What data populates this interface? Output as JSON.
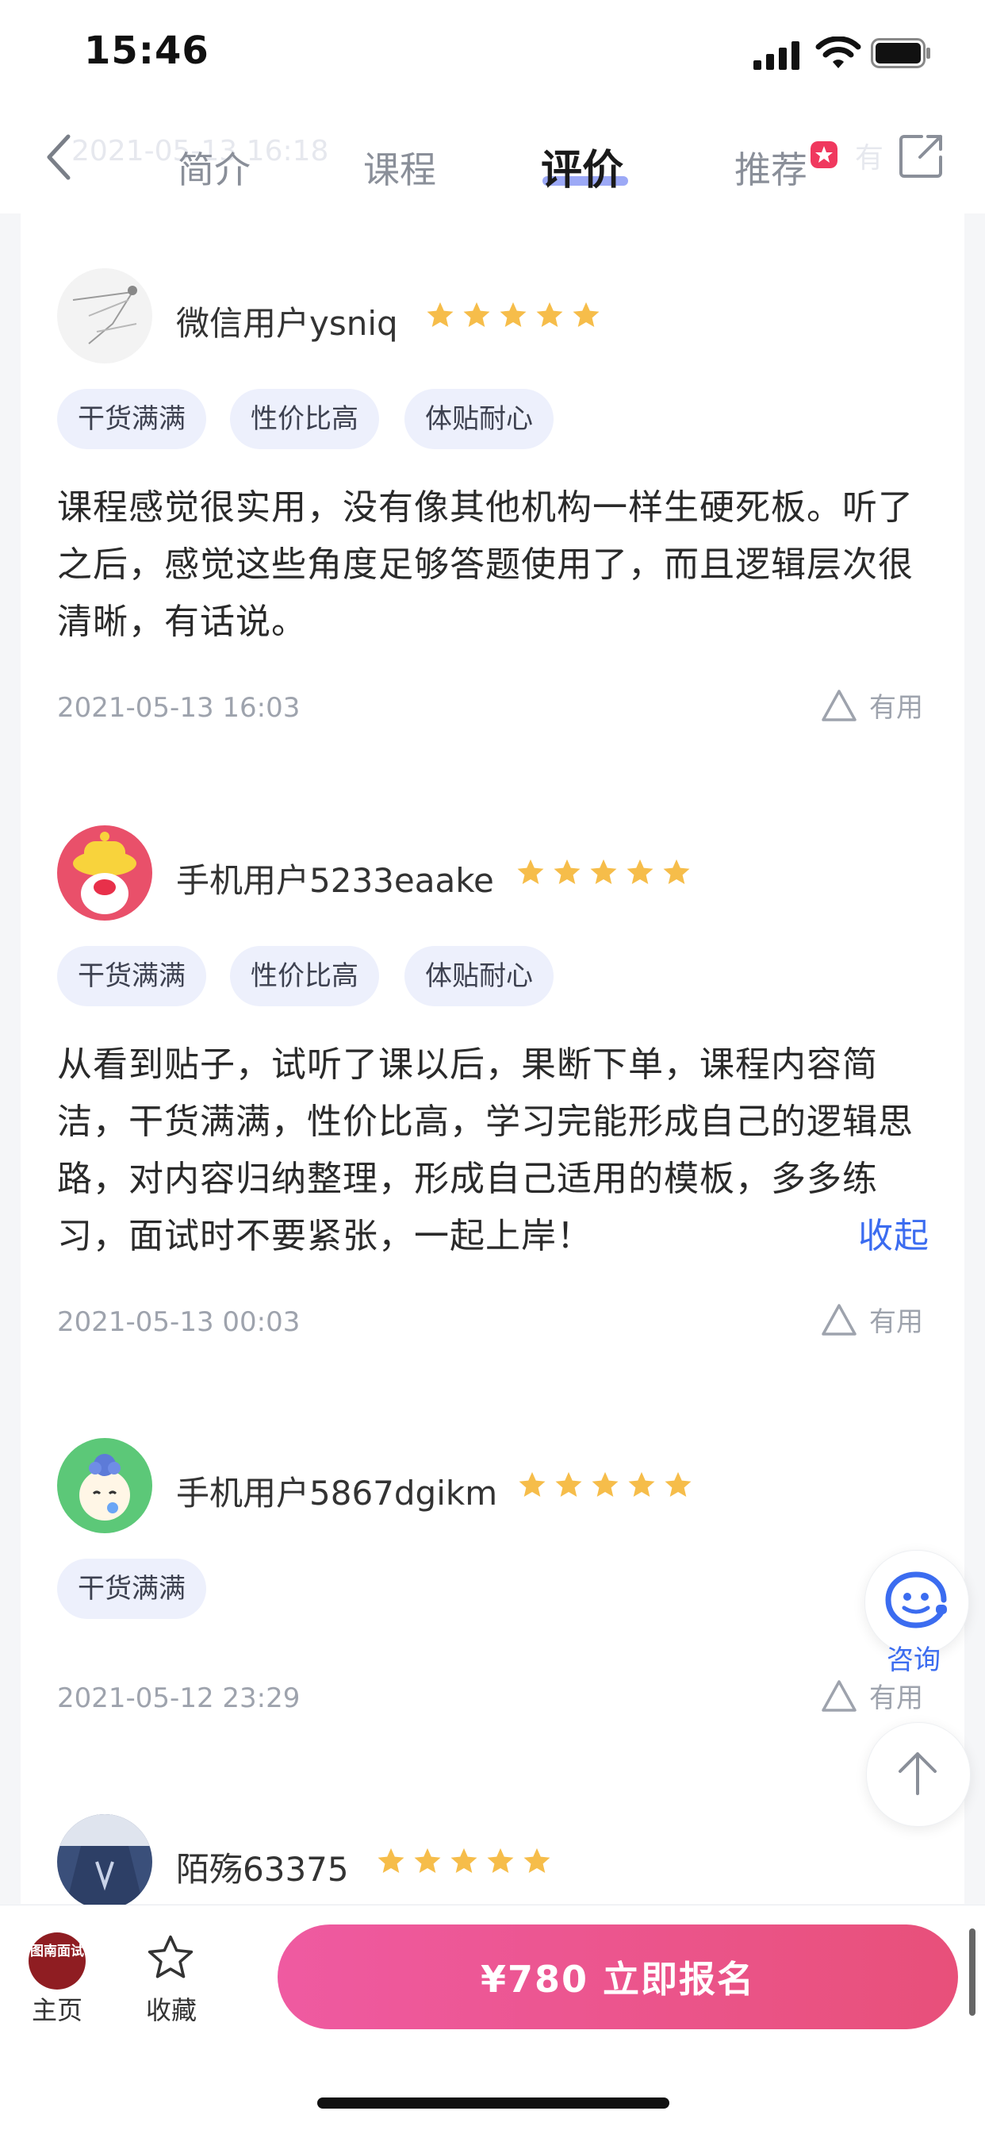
{
  "status_bar": {
    "time": "15:46"
  },
  "nav": {
    "tabs": [
      {
        "label": "简介"
      },
      {
        "label": "课程"
      },
      {
        "label": "评价",
        "active": true
      },
      {
        "label": "推荐"
      }
    ],
    "ghost_date": "2021-05-13 16:18",
    "ghost_useful": "有"
  },
  "reviews": [
    {
      "user": "微信用户ysniq",
      "rating": 5,
      "tags": [
        "干货满满",
        "性价比高",
        "体贴耐心"
      ],
      "text": "课程感觉很实用，没有像其他机构一样生硬死板。听了之后，感觉这些角度足够答题使用了，而且逻辑层次很清晰，有话说。",
      "time": "2021-05-13 16:03",
      "useful_label": "有用"
    },
    {
      "user": "手机用户5233eaake",
      "rating": 5,
      "tags": [
        "干货满满",
        "性价比高",
        "体贴耐心"
      ],
      "text": "从看到贴子，试听了课以后，果断下单，课程内容简洁，干货满满，性价比高，学习完能形成自己的逻辑思路，对内容归纳整理，形成自己适用的模板，多多练习，面试时不要紧张，一起上岸！",
      "collapse_label": "收起",
      "time": "2021-05-13 00:03",
      "useful_label": "有用"
    },
    {
      "user": "手机用户5867dgikm",
      "rating": 5,
      "tags": [
        "干货满满"
      ],
      "time": "2021-05-12 23:29",
      "useful_label": "有用"
    },
    {
      "user": "陌殇63375",
      "rating": 5
    }
  ],
  "floating": {
    "consult_label": "咨询"
  },
  "bottom_bar": {
    "logo_text": "图南面试",
    "home_label": "主页",
    "favorite_label": "收藏",
    "enroll_label": "¥780 立即报名"
  },
  "colors": {
    "accent_blue": "#3b6cf0",
    "star": "#f6bd4a",
    "enroll_start": "#ef5aa1",
    "enroll_end": "#e8507a",
    "tag_bg": "#edf0fc"
  },
  "icons": [
    "back-icon",
    "share-icon",
    "star-icon",
    "triangle-useful-icon",
    "consult-icon",
    "back-to-top-icon",
    "favorite-star-icon",
    "signal-icon",
    "wifi-icon",
    "battery-icon"
  ]
}
